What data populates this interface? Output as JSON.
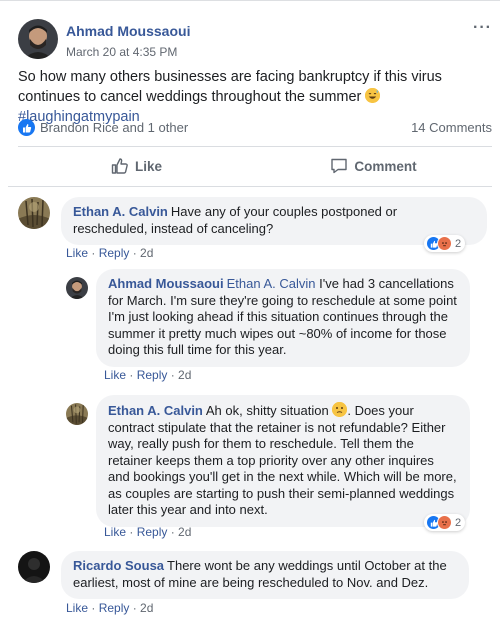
{
  "post": {
    "author": "Ahmad Moussaoui",
    "timestamp": "March 20 at 4:35 PM",
    "more_label": "···",
    "text": "So how many others businesses are facing bankruptcy if this virus continues to cancel weddings throughout the summer",
    "hashtag": "#laughingatmypain",
    "reactions_summary": "Brandon Rice and 1 other",
    "comments_count": "14 Comments",
    "like_label": "Like",
    "comment_label": "Comment"
  },
  "comments": [
    {
      "author": "Ethan A. Calvin",
      "text": "Have any of your couples postponed or rescheduled, instead of canceling?",
      "like": "Like",
      "reply": "Reply",
      "age": "2d",
      "reaction_count": "2"
    },
    {
      "author": "Ahmad Moussaoui",
      "mention": "Ethan A. Calvin",
      "text": "I've had 3 cancellations for March. I'm sure they're going to reschedule at some point I'm just looking ahead if this situation continues through the summer it pretty much wipes out ~80% of income for those doing this full time for this year.",
      "like": "Like",
      "reply": "Reply",
      "age": "2d"
    },
    {
      "author": "Ethan A. Calvin",
      "text_a": "Ah ok, shitty situation",
      "text_b": ". Does your contract stipulate that the retainer is not refundable? Either way, really push for them to reschedule. Tell them the retainer keeps them a top priority over any other inquires and bookings you'll get in the next while. Which will be more, as couples are starting to push their semi-planned weddings later this year and into next.",
      "like": "Like",
      "reply": "Reply",
      "age": "2d",
      "reaction_count": "2"
    },
    {
      "author": "Ricardo Sousa",
      "text": "There wont be any weddings until October at the earliest, most of mine are being rescheduled to Nov. and Dez.",
      "like": "Like",
      "reply": "Reply",
      "age": "2d"
    }
  ],
  "colors": {
    "link": "#385898",
    "facebook_blue": "#1877f2",
    "bubble": "#f2f3f5",
    "meta_gray": "#606770"
  }
}
